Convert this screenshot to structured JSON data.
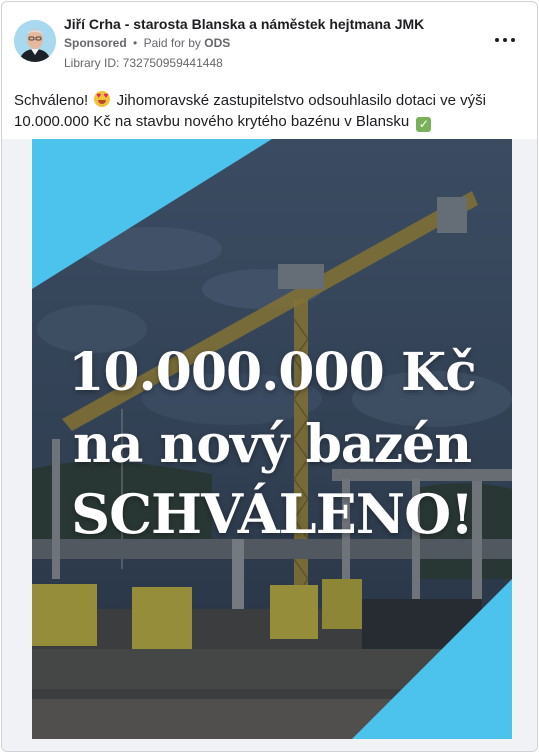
{
  "post": {
    "page_name": "Jiří Crha - starosta Blanska a náměstek hejtmana JMK",
    "sponsored_label": "Sponsored",
    "separator": "•",
    "paid_for_prefix": "Paid for by",
    "paid_for_by": "ODS",
    "library_id": "Library ID: 732750959441448",
    "text_part1": "Schváleno!",
    "text_part2": "Jihomoravské zastupitelstvo odsouhlasilo dotaci ve výši 10.000.000 Kč na stavbu nového krytého bazénu v Blansku",
    "emoji_1": "smiling-face-with-heart-eyes",
    "emoji_2": "check-mark-button"
  },
  "ad_image": {
    "line1": "10.000.000 Kč",
    "line2": "na nový bazén",
    "line3": "SCHVÁLENO!",
    "accent_color": "#4cc3ec",
    "overlay_color": "#1f2d40"
  },
  "icons": {
    "more": "more-horizontal-icon",
    "avatar": "profile-avatar"
  }
}
